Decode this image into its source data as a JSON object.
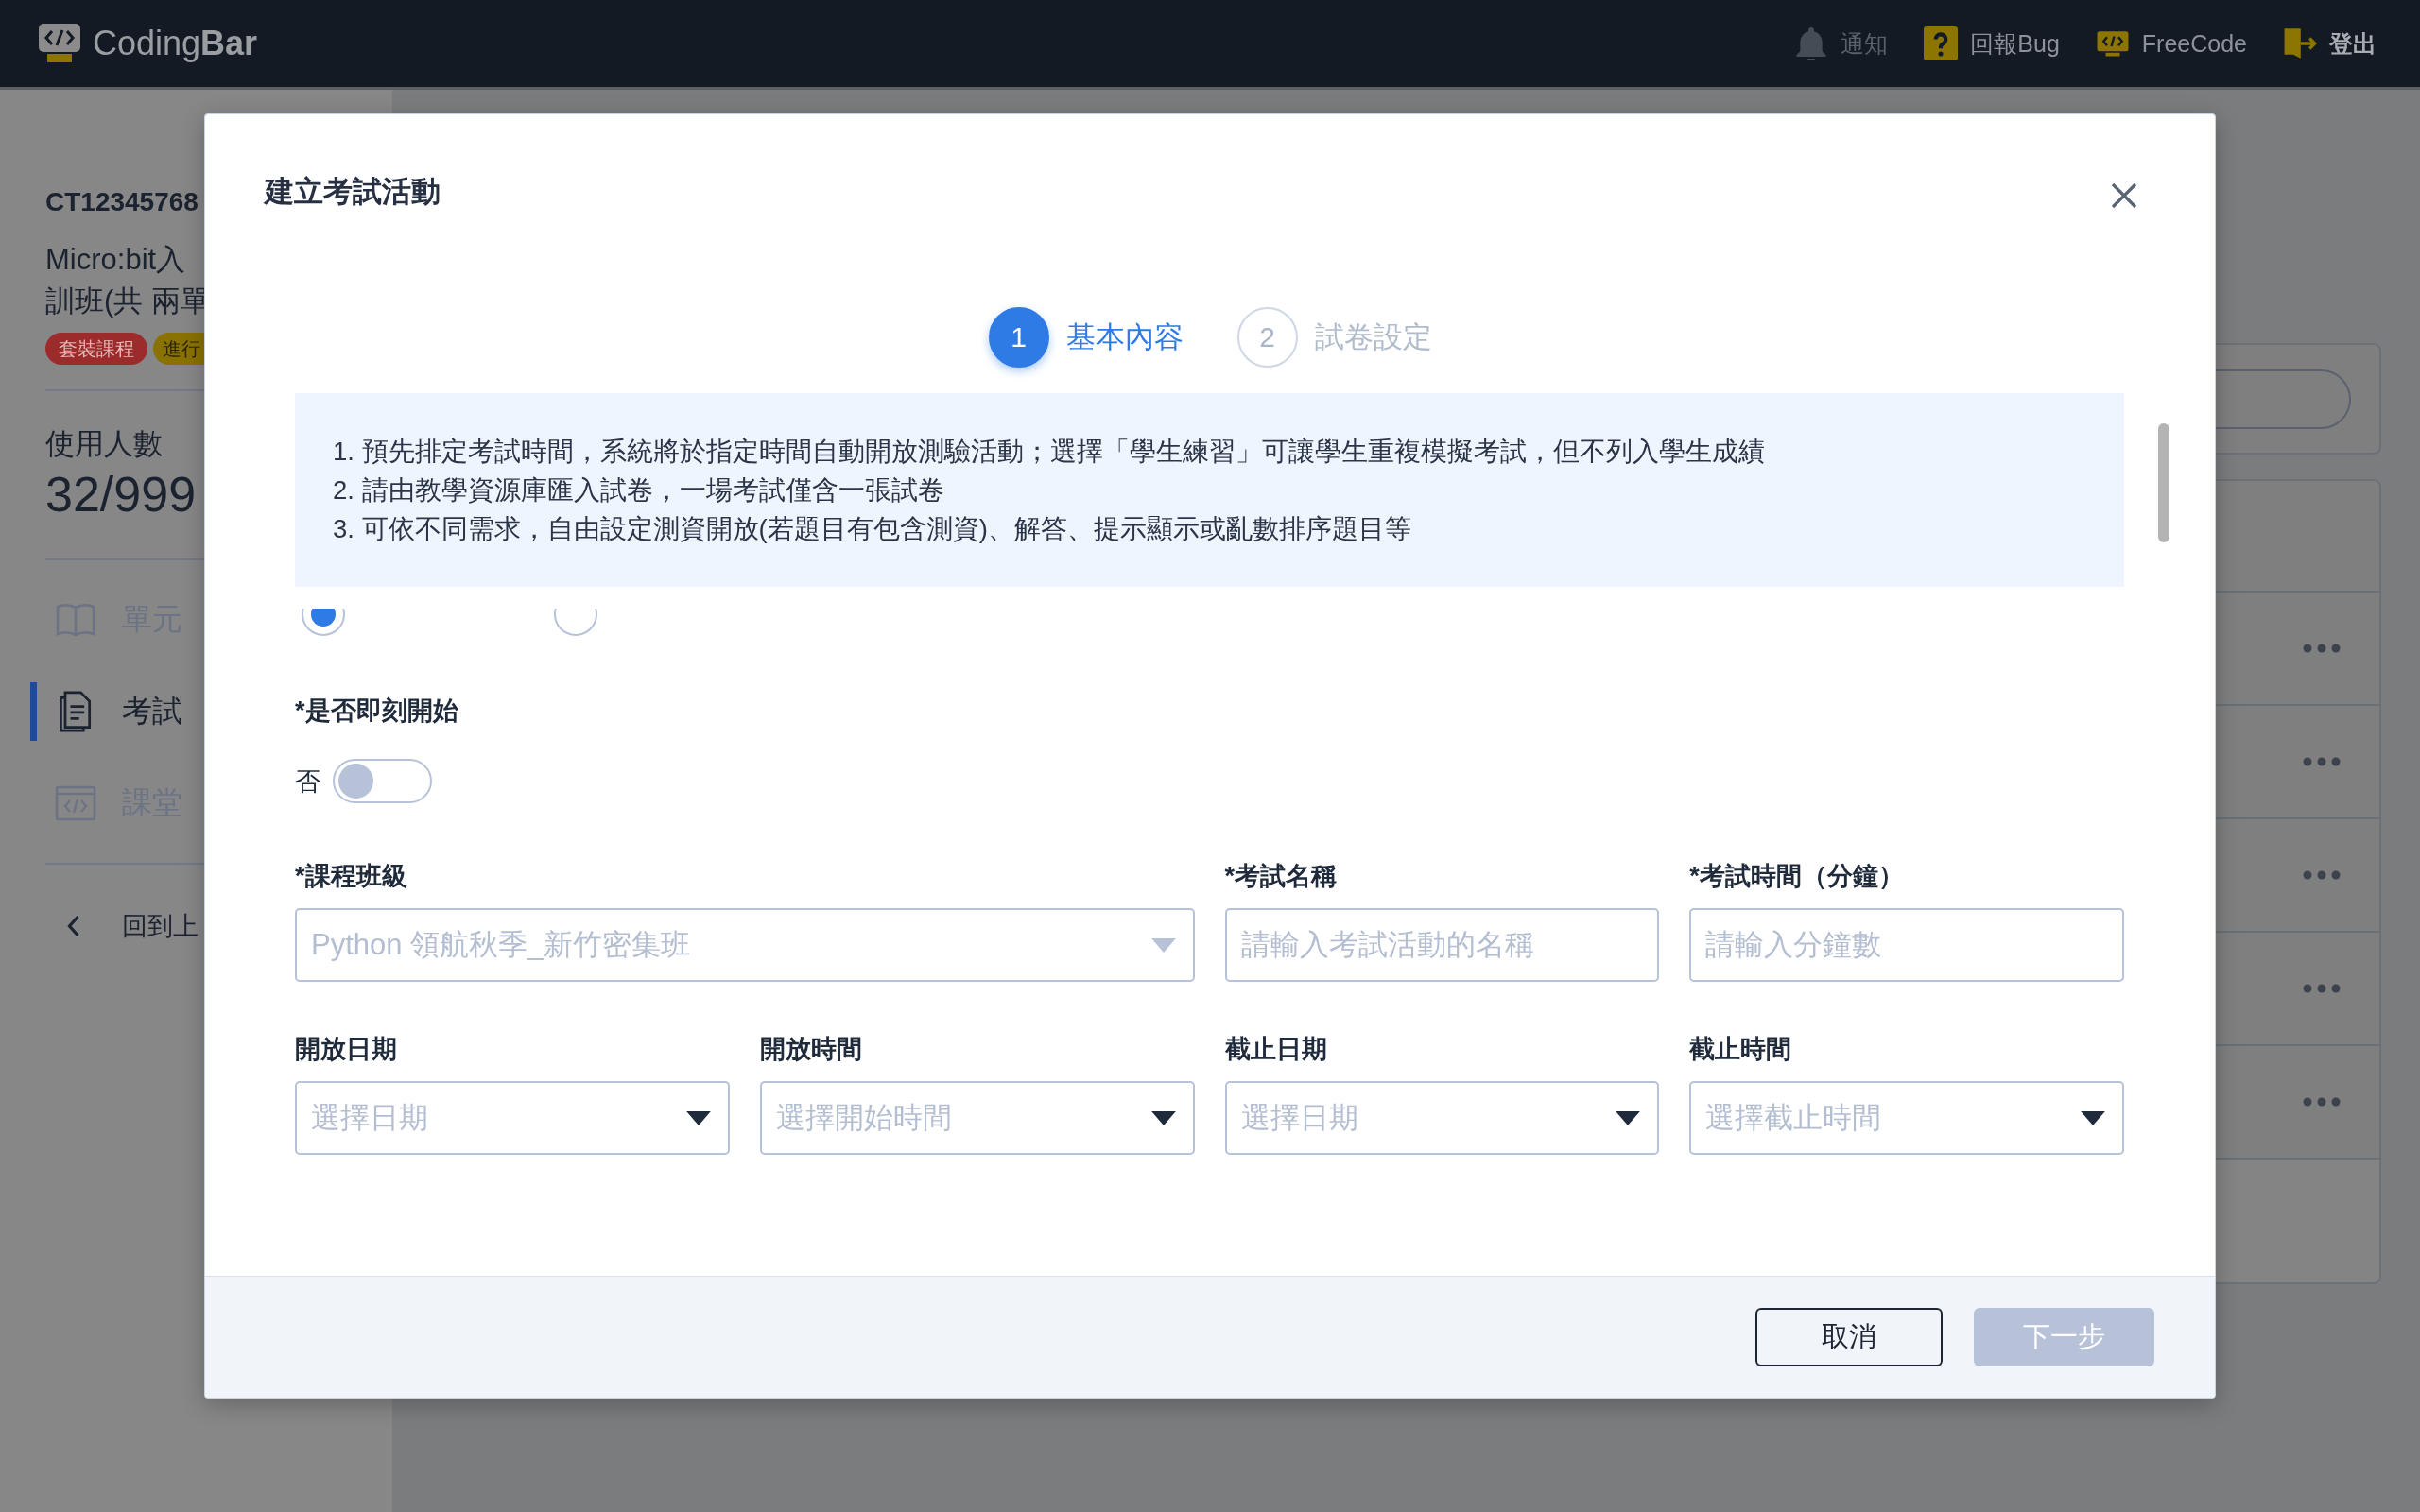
{
  "top_bar": {
    "logo": "Coding**Bar**",
    "nav": [
      {
        "kind": "bell",
        "label": "通知",
        "disabled": true
      },
      {
        "kind": "question",
        "label": "回報Bug",
        "disabled": false
      },
      {
        "kind": "monitor",
        "label": "FreeCode",
        "disabled": false
      },
      {
        "kind": "logout",
        "label": "登出",
        "disabled": false
      }
    ]
  },
  "sidebar": {
    "course_code": "CT12345768",
    "course_title_lines": [
      "Micro:bit入",
      "訓班(共 兩單"
    ],
    "tags": [
      {
        "label": "套裝課程",
        "color": "#9c2b2b"
      },
      {
        "label": "進行",
        "color": "#8a7200"
      }
    ],
    "usage": {
      "label": "使用人數",
      "value": "32/999"
    },
    "menu": [
      {
        "kind": "book",
        "label": "單元",
        "selected": false
      },
      {
        "kind": "document",
        "label": "考試",
        "selected": true
      },
      {
        "kind": "code",
        "label": "課堂",
        "selected": false
      }
    ],
    "back_link": "回到上"
  },
  "dialog": {
    "title": "建立考試活動",
    "steps": [
      {
        "number": "1",
        "label": "基本內容",
        "selected": true
      },
      {
        "number": "2",
        "label": "試卷設定",
        "selected": false
      }
    ],
    "notes": [
      "1. 預先排定考試時間，系統將於指定時間自動開放測驗活動；選擇「學生練習」可讓學生重複模擬考試，但不列入學生成績",
      "2. 請由教學資源庫匯入試卷，一場考試僅含一張試卷",
      "3. 可依不同需求，自由設定測資開放(若題目有包含測資)、解答、提示顯示或亂數排序題目等"
    ],
    "exam_type_options": [
      {
        "selected": true
      },
      {
        "selected": false
      }
    ],
    "start_now": {
      "label": "*是否即刻開始",
      "state_label": "否",
      "on": false
    },
    "field_rows": [
      [
        {
          "kind": "select",
          "label": "*課程班級",
          "value": "Python 領航秋季_新竹密集班",
          "disabled": true
        },
        {
          "kind": "text",
          "label": "*考試名稱",
          "placeholder": "請輸入考試活動的名稱",
          "disabled": false
        },
        {
          "kind": "text",
          "label": "*考試時間（分鐘）",
          "placeholder": "請輸入分鐘數",
          "disabled": false
        }
      ],
      [
        {
          "kind": "select",
          "label": "開放日期",
          "placeholder": "選擇日期",
          "disabled": false
        },
        {
          "kind": "select",
          "label": "開放時間",
          "placeholder": "選擇開始時間",
          "disabled": false
        },
        {
          "kind": "select",
          "label": "截止日期",
          "placeholder": "選擇日期",
          "disabled": false
        },
        {
          "kind": "select",
          "label": "截止時間",
          "placeholder": "選擇截止時間",
          "disabled": false
        }
      ]
    ],
    "buttons": [
      {
        "kind": "secondary",
        "label": "取消",
        "disabled": false
      },
      {
        "kind": "primary",
        "label": "下一步",
        "disabled": true
      }
    ]
  }
}
